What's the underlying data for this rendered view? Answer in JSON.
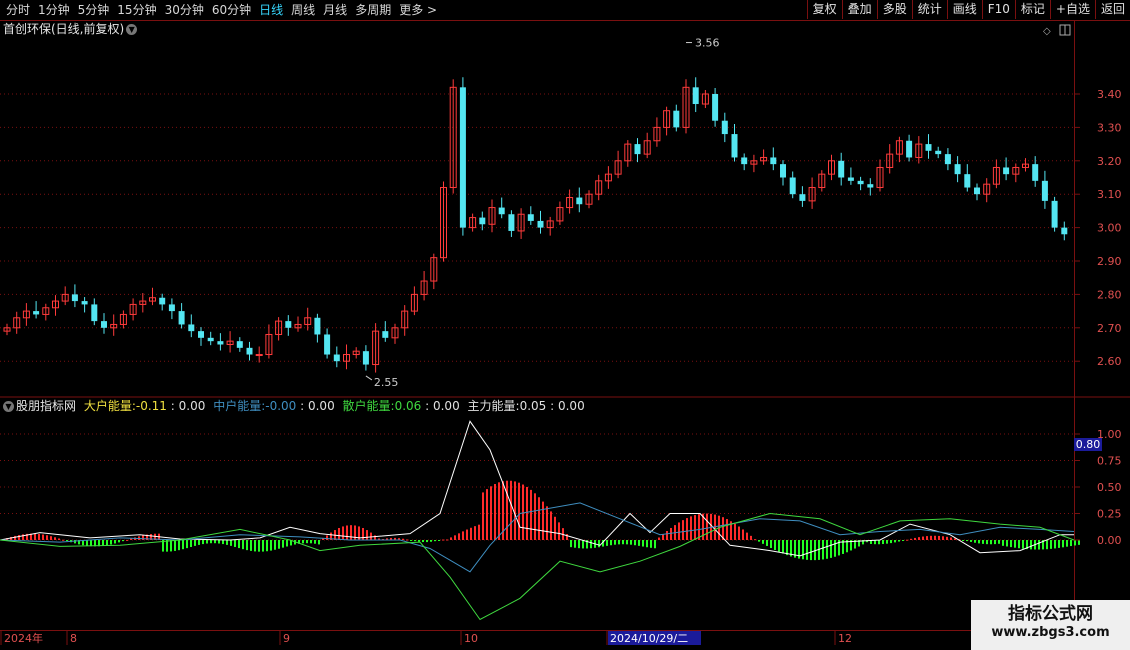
{
  "toolbar": {
    "periods": [
      "分时",
      "1分钟",
      "5分钟",
      "15分钟",
      "30分钟",
      "60分钟",
      "日线",
      "周线",
      "月线",
      "多周期",
      "更多 >"
    ],
    "active_period": "日线",
    "tools": [
      "复权",
      "叠加",
      "多股",
      "统计",
      "画线",
      "F10",
      "标记",
      "+自选",
      "返回"
    ]
  },
  "stock": {
    "title": "首创环保(日线,前复权)",
    "high_label": "3.56",
    "low_label": "2.55"
  },
  "price_axis": [
    "3.40",
    "3.30",
    "3.20",
    "3.10",
    "3.00",
    "2.90",
    "2.80",
    "2.70",
    "2.60"
  ],
  "indicator": {
    "name": "股朋指标网",
    "items": [
      {
        "label": "大户能量:",
        "value": "-0.11",
        "extra": ": 0.00",
        "color": "#f0e040"
      },
      {
        "label": "中户能量:",
        "value": "-0.00",
        "extra": ": 0.00",
        "color": "#3f8ec0"
      },
      {
        "label": "散户能量:",
        "value": "0.06",
        "extra": ": 0.00",
        "color": "#3fd83f"
      },
      {
        "label": "主力能量:",
        "value": "0.05",
        "extra": ": 0.00",
        "color": "#e0e0e0"
      }
    ],
    "axis": [
      "1.00",
      "0.75",
      "0.50",
      "0.25",
      "0.00"
    ],
    "crosshair_value": "0.80"
  },
  "date_axis": [
    "2024年",
    "8",
    "9",
    "10",
    "2024/10/29/二",
    "12"
  ],
  "watermark": {
    "line1": "指标公式网",
    "line2": "www.zbgs3.com"
  },
  "colors": {
    "up": "#ff3b3b",
    "down": "#54e6f2",
    "grid": "#7a1010",
    "axis_text": "#e05050"
  }
}
